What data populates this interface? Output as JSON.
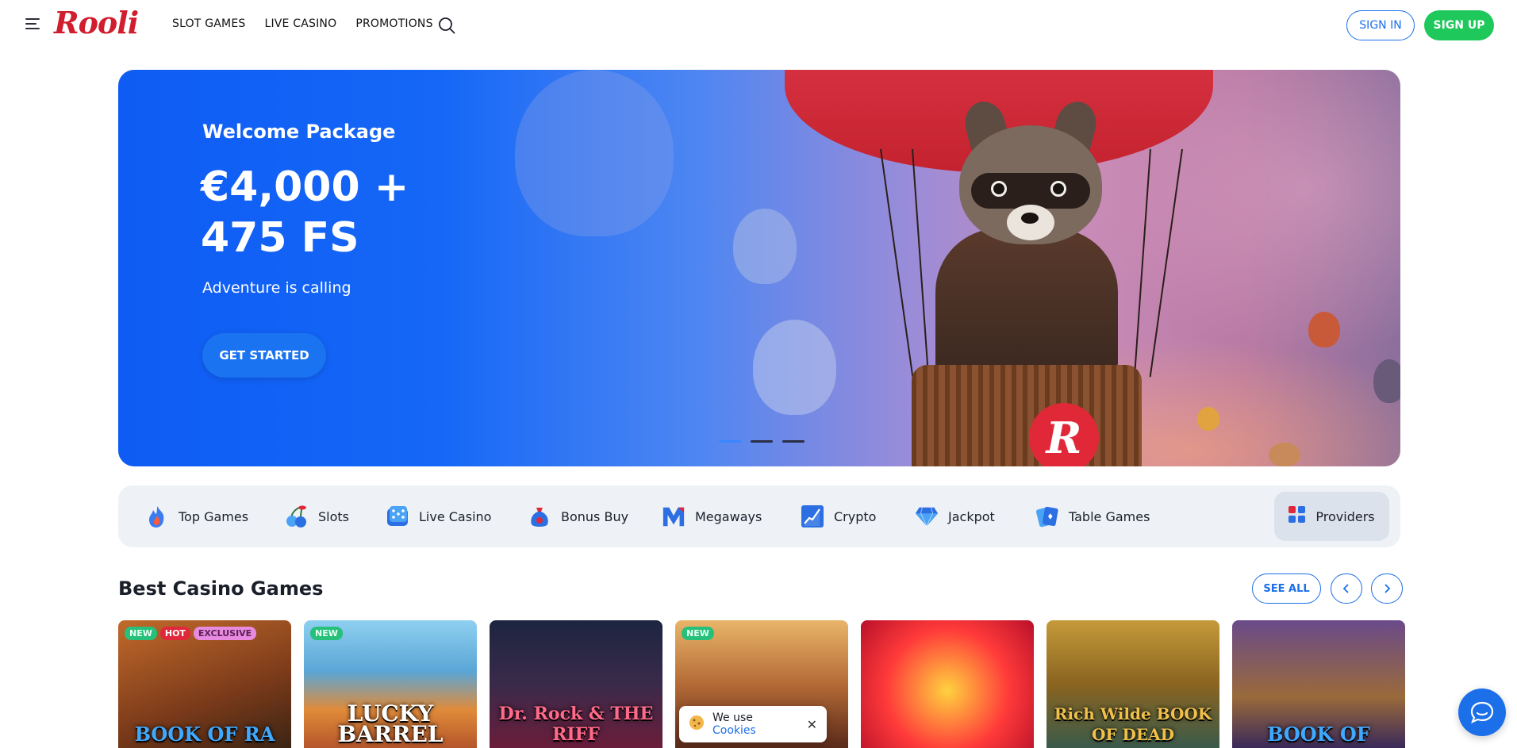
{
  "header": {
    "logo_text": "Rooli",
    "nav": [
      "SLOT GAMES",
      "LIVE CASINO",
      "PROMOTIONS"
    ],
    "sign_in": "SIGN IN",
    "sign_up": "SIGN UP"
  },
  "hero": {
    "title": "Welcome Package",
    "amount": "€4,000 + 475 FS",
    "subtitle": "Adventure is calling",
    "cta": "GET STARTED",
    "badge_letter": "R"
  },
  "categories": [
    {
      "label": "Top Games",
      "icon": "fire-icon"
    },
    {
      "label": "Slots",
      "icon": "cherry-icon"
    },
    {
      "label": "Live Casino",
      "icon": "dice-icon"
    },
    {
      "label": "Bonus Buy",
      "icon": "money-bag-icon"
    },
    {
      "label": "Megaways",
      "icon": "megaways-icon"
    },
    {
      "label": "Crypto",
      "icon": "crypto-chart-icon"
    },
    {
      "label": "Jackpot",
      "icon": "diamond-icon"
    },
    {
      "label": "Table Games",
      "icon": "cards-icon"
    }
  ],
  "providers_label": "Providers",
  "section": {
    "title": "Best Casino Games",
    "see_all": "SEE ALL"
  },
  "games": [
    {
      "name": "BOOK OF RA",
      "badges": [
        "NEW",
        "HOT",
        "EXCLUSIVE"
      ]
    },
    {
      "name": "LUCKY BARREL",
      "badges": [
        "NEW"
      ]
    },
    {
      "name": "Dr. Rock & THE RIFF",
      "badges": []
    },
    {
      "name": "",
      "badges": [
        "NEW"
      ]
    },
    {
      "name": "",
      "badges": []
    },
    {
      "name": "Rich Wilde BOOK OF DEAD",
      "badges": []
    },
    {
      "name": "BOOK OF",
      "badges": []
    }
  ],
  "cookie": {
    "text": "We use",
    "link": "Cookies"
  },
  "colors": {
    "brand_red": "#d01e2f",
    "accent_blue": "#1b6fe8",
    "signup_green": "#1ec85a"
  }
}
